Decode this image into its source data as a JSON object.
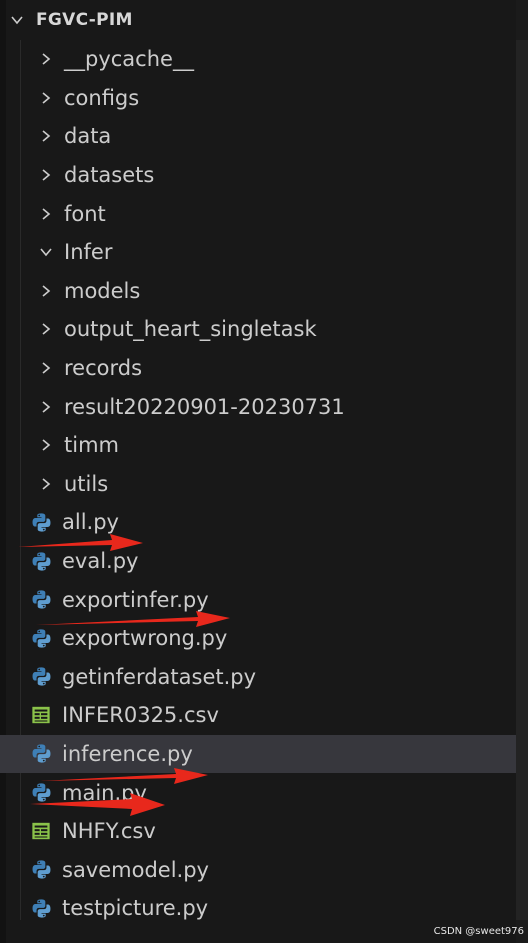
{
  "explorer": {
    "section_title": "FGVC-PIM",
    "items": [
      {
        "label": "__pycache__",
        "kind": "folder",
        "expanded": false
      },
      {
        "label": "configs",
        "kind": "folder",
        "expanded": false
      },
      {
        "label": "data",
        "kind": "folder",
        "expanded": false
      },
      {
        "label": "datasets",
        "kind": "folder",
        "expanded": false
      },
      {
        "label": "font",
        "kind": "folder",
        "expanded": false
      },
      {
        "label": "Infer",
        "kind": "folder",
        "expanded": true
      },
      {
        "label": "models",
        "kind": "folder",
        "expanded": false
      },
      {
        "label": "output_heart_singletask",
        "kind": "folder",
        "expanded": false
      },
      {
        "label": "records",
        "kind": "folder",
        "expanded": false
      },
      {
        "label": "result20220901-20230731",
        "kind": "folder",
        "expanded": false
      },
      {
        "label": "timm",
        "kind": "folder",
        "expanded": false
      },
      {
        "label": "utils",
        "kind": "folder",
        "expanded": false
      },
      {
        "label": "all.py",
        "kind": "python"
      },
      {
        "label": "eval.py",
        "kind": "python"
      },
      {
        "label": "exportinfer.py",
        "kind": "python"
      },
      {
        "label": "exportwrong.py",
        "kind": "python"
      },
      {
        "label": "getinferdataset.py",
        "kind": "python"
      },
      {
        "label": "INFER0325.csv",
        "kind": "csv"
      },
      {
        "label": "inference.py",
        "kind": "python",
        "selected": true
      },
      {
        "label": "main.py",
        "kind": "python"
      },
      {
        "label": "NHFY.csv",
        "kind": "csv"
      },
      {
        "label": "savemodel.py",
        "kind": "python"
      },
      {
        "label": "testpicture.py",
        "kind": "python"
      }
    ]
  },
  "icons": {
    "folder_chevron": "chevron-right-icon",
    "folder_chevron_open": "chevron-down-icon",
    "python": "python-icon",
    "csv": "spreadsheet-icon"
  },
  "colors": {
    "background": "#181818",
    "selected_row": "#37373d",
    "text": "#cccccc",
    "python_blue": "#3e7fb6",
    "python_yellow": "#e3c84c",
    "csv_green": "#8bc34a",
    "annotation_arrow": "#e8281c"
  },
  "watermark": "CSDN @sweet976"
}
